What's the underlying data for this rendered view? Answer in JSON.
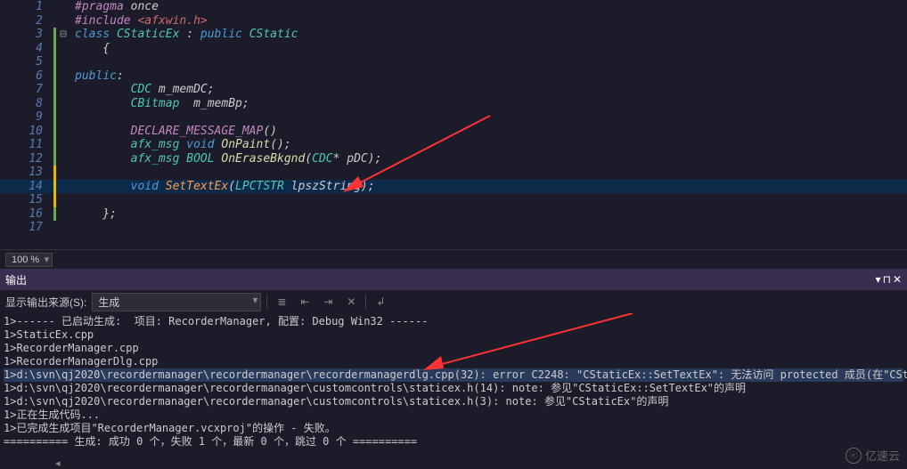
{
  "editor": {
    "zoom": "100 %",
    "lines": {
      "l1": {
        "n": "1",
        "t": [
          "    ",
          "#pragma",
          " once"
        ],
        "c": [
          "",
          "inc",
          ""
        ]
      },
      "l2": {
        "n": "2",
        "t": [
          "    ",
          "#include",
          " ",
          "<afxwin.h>"
        ],
        "c": [
          "",
          "inc",
          "",
          "str"
        ]
      },
      "l3": {
        "n": "3",
        "t": [
          "  ",
          "class",
          " ",
          "CStaticEx",
          " : ",
          "public",
          " ",
          "CStatic"
        ],
        "c": [
          "",
          "kw",
          "",
          "type",
          "",
          "kw",
          "",
          "type"
        ]
      },
      "l4": {
        "n": "4",
        "t": [
          "    {"
        ]
      },
      "l5": {
        "n": "5",
        "t": [
          ""
        ]
      },
      "l6": {
        "n": "6",
        "t": [
          "    ",
          "public",
          ":"
        ],
        "c": [
          "",
          "kw",
          ""
        ]
      },
      "l7": {
        "n": "7",
        "t": [
          "        ",
          "CDC",
          " m_memDC;"
        ],
        "c": [
          "",
          "type",
          ""
        ]
      },
      "l8": {
        "n": "8",
        "t": [
          "        ",
          "CBitmap",
          "  m_memBp;"
        ],
        "c": [
          "",
          "type",
          ""
        ]
      },
      "l9": {
        "n": "9",
        "t": [
          ""
        ]
      },
      "l10": {
        "n": "10",
        "t": [
          "        ",
          "DECLARE_MESSAGE_MAP",
          "()"
        ],
        "c": [
          "",
          "inc",
          ""
        ]
      },
      "l11": {
        "n": "11",
        "t": [
          "        ",
          "afx_msg",
          " ",
          "void",
          " ",
          "OnPaint",
          "();"
        ],
        "c": [
          "",
          "type",
          "",
          "kw",
          "",
          "method",
          ""
        ]
      },
      "l12": {
        "n": "12",
        "t": [
          "        ",
          "afx_msg",
          " ",
          "BOOL",
          " ",
          "OnEraseBkgnd",
          "(",
          "CDC",
          "* pDC);"
        ],
        "c": [
          "",
          "type",
          "",
          "type",
          "",
          "method",
          "",
          "type",
          ""
        ]
      },
      "l13": {
        "n": "13",
        "t": [
          ""
        ]
      },
      "l14": {
        "n": "14",
        "t": [
          "        ",
          "void",
          " ",
          "SetTextEx",
          "(",
          "LPCTSTR",
          " lpszString);"
        ],
        "c": [
          "",
          "kw",
          "",
          "fn",
          "",
          "type",
          ""
        ]
      },
      "l15": {
        "n": "15",
        "t": [
          ""
        ]
      },
      "l16": {
        "n": "16",
        "t": [
          "    };"
        ]
      },
      "l17": {
        "n": "17",
        "t": [
          ""
        ]
      }
    }
  },
  "output": {
    "title": "输出",
    "src_label": "显示输出来源(S):",
    "src_value": "生成",
    "lines": [
      "1>------ 已启动生成:  项目: RecorderManager, 配置: Debug Win32 ------",
      "1>StaticEx.cpp",
      "1>RecorderManager.cpp",
      "1>RecorderManagerDlg.cpp",
      "1>d:\\svn\\qj2020\\recordermanager\\recordermanager\\recordermanagerdlg.cpp(32): error C2248: \"CStaticEx::SetTextEx\": 无法访问 protected 成员(在\"CStaticEx\"类中声明)",
      "1>d:\\svn\\qj2020\\recordermanager\\recordermanager\\customcontrols\\staticex.h(14): note: 参见\"CStaticEx::SetTextEx\"的声明",
      "1>d:\\svn\\qj2020\\recordermanager\\recordermanager\\customcontrols\\staticex.h(3): note: 参见\"CStaticEx\"的声明",
      "1>正在生成代码...",
      "1>已完成生成项目\"RecorderManager.vcxproj\"的操作 - 失败。",
      "========== 生成: 成功 0 个，失败 1 个，最新 0 个，跳过 0 个 =========="
    ]
  },
  "watermark": "亿速云"
}
